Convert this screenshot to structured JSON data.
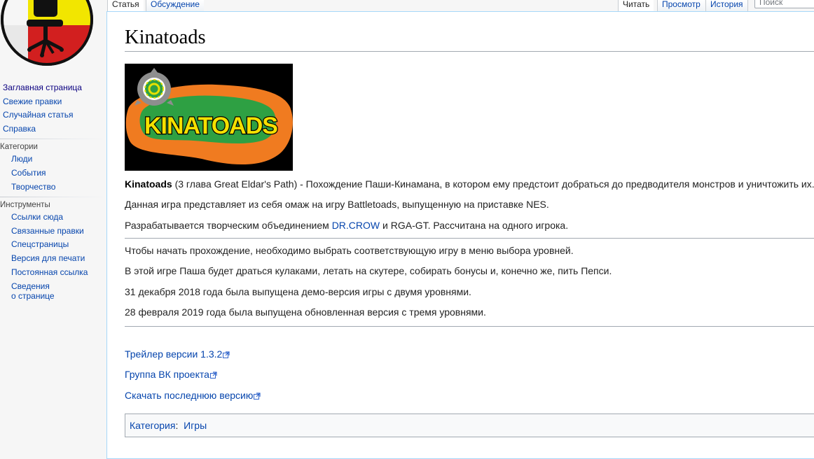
{
  "sidebar": {
    "main": [
      {
        "label": "Заглавная страница",
        "visited": true
      },
      {
        "label": "Свежие правки",
        "visited": false
      },
      {
        "label": "Случайная статья",
        "visited": false
      },
      {
        "label": "Справка",
        "visited": false
      }
    ],
    "categories_heading": "Категории",
    "categories": [
      "Люди",
      "События",
      "Творчество"
    ],
    "tools_heading": "Инструменты",
    "tools": [
      "Ссылки сюда",
      "Связанные правки",
      "Спецстраницы",
      "Версия для печати",
      "Постоянная ссылка"
    ],
    "tools_last_line1": "Сведения",
    "tools_last_line2": "о странице"
  },
  "tabs": {
    "article": "Статья",
    "talk": "Обсуждение",
    "read": "Читать",
    "view": "Просмотр",
    "history": "История"
  },
  "search": {
    "placeholder": "Поиск"
  },
  "page": {
    "title": "Kinatoads",
    "image_text": "KINATOADS",
    "intro_bold": "Kinatoads",
    "intro_rest": " (3 глава Great Eldar's Path) - Похождение Паши-Кинамана, в котором ему предстоит добраться до предводителя монстров и уничтожить их.",
    "p2": "Данная игра представляет из себя омаж на игру Battletoads, выпущенную на приставке NES.",
    "p3_a": "Разрабатывается творческим объединением ",
    "p3_link": "DR.CROW",
    "p3_b": " и RGA-GT. Рассчитана на одного игрока.",
    "p4": "Чтобы начать прохождение, необходимо выбрать соответствующую игру в меню выбора уровней.",
    "p5": "В этой игре Паша будет драться кулаками, летать на скутере, собирать бонусы и, конечно же, пить Пепси.",
    "p6": "31 декабря 2018 года была выпущена демо-версия игры с двумя уровнями.",
    "p7": "28 февраля 2019 года была выпущена обновленная версия с тремя уровнями.",
    "links": [
      "Трейлер версии 1.3.2",
      "Группа ВК проекта",
      "Скачать последнюю версию"
    ],
    "category_label": "Категория",
    "category_value": "Игры"
  },
  "colors": {
    "link": "#0645ad",
    "visited_link": "#0b0080",
    "content_border": "#a7d7f9"
  }
}
